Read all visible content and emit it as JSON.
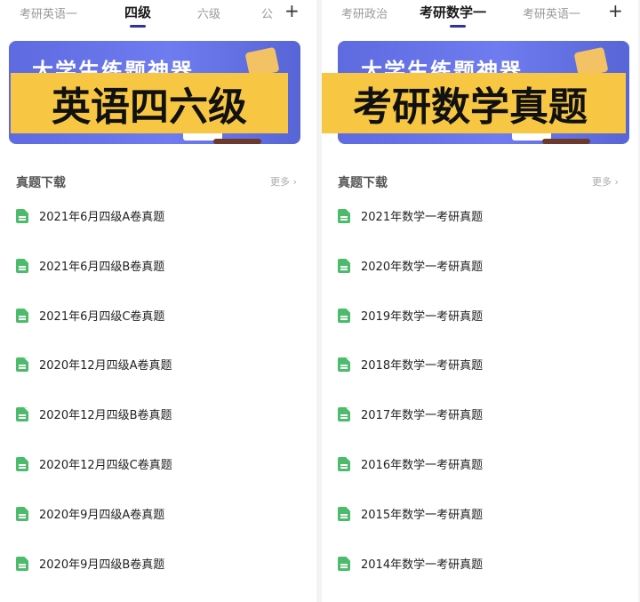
{
  "left": {
    "tabs": [
      {
        "label": "考研英语一",
        "active": false
      },
      {
        "label": "四级",
        "active": true
      },
      {
        "label": "六级",
        "active": false
      },
      {
        "label": "公",
        "active": false
      }
    ],
    "plus_label": "+",
    "banner_subtitle": "大学生练题神器",
    "overlay_title": "英语四六级",
    "section_title": "真题下载",
    "more_label": "更多 ›",
    "items": [
      "2021年6月四级A卷真题",
      "2021年6月四级B卷真题",
      "2021年6月四级C卷真题",
      "2020年12月四级A卷真题",
      "2020年12月四级B卷真题",
      "2020年12月四级C卷真题",
      "2020年9月四级A卷真题",
      "2020年9月四级B卷真题"
    ]
  },
  "right": {
    "tabs": [
      {
        "label": "考研政治",
        "active": false
      },
      {
        "label": "考研数学一",
        "active": true
      },
      {
        "label": "考研英语一",
        "active": false
      }
    ],
    "plus_label": "+",
    "banner_subtitle": "大学生练题神器",
    "overlay_title": "考研数学真题",
    "section_title": "真题下载",
    "more_label": "更多 ›",
    "items": [
      "2021年数学一考研真题",
      "2020年数学一考研真题",
      "2019年数学一考研真题",
      "2018年数学一考研真题",
      "2017年数学一考研真题",
      "2016年数学一考研真题",
      "2015年数学一考研真题",
      "2014年数学一考研真题"
    ]
  },
  "colors": {
    "accent_underline": "#333399",
    "overlay_yellow": "#f7c744",
    "doc_icon_green": "#4cbb6b",
    "banner_blue": "#6f7cf0"
  }
}
